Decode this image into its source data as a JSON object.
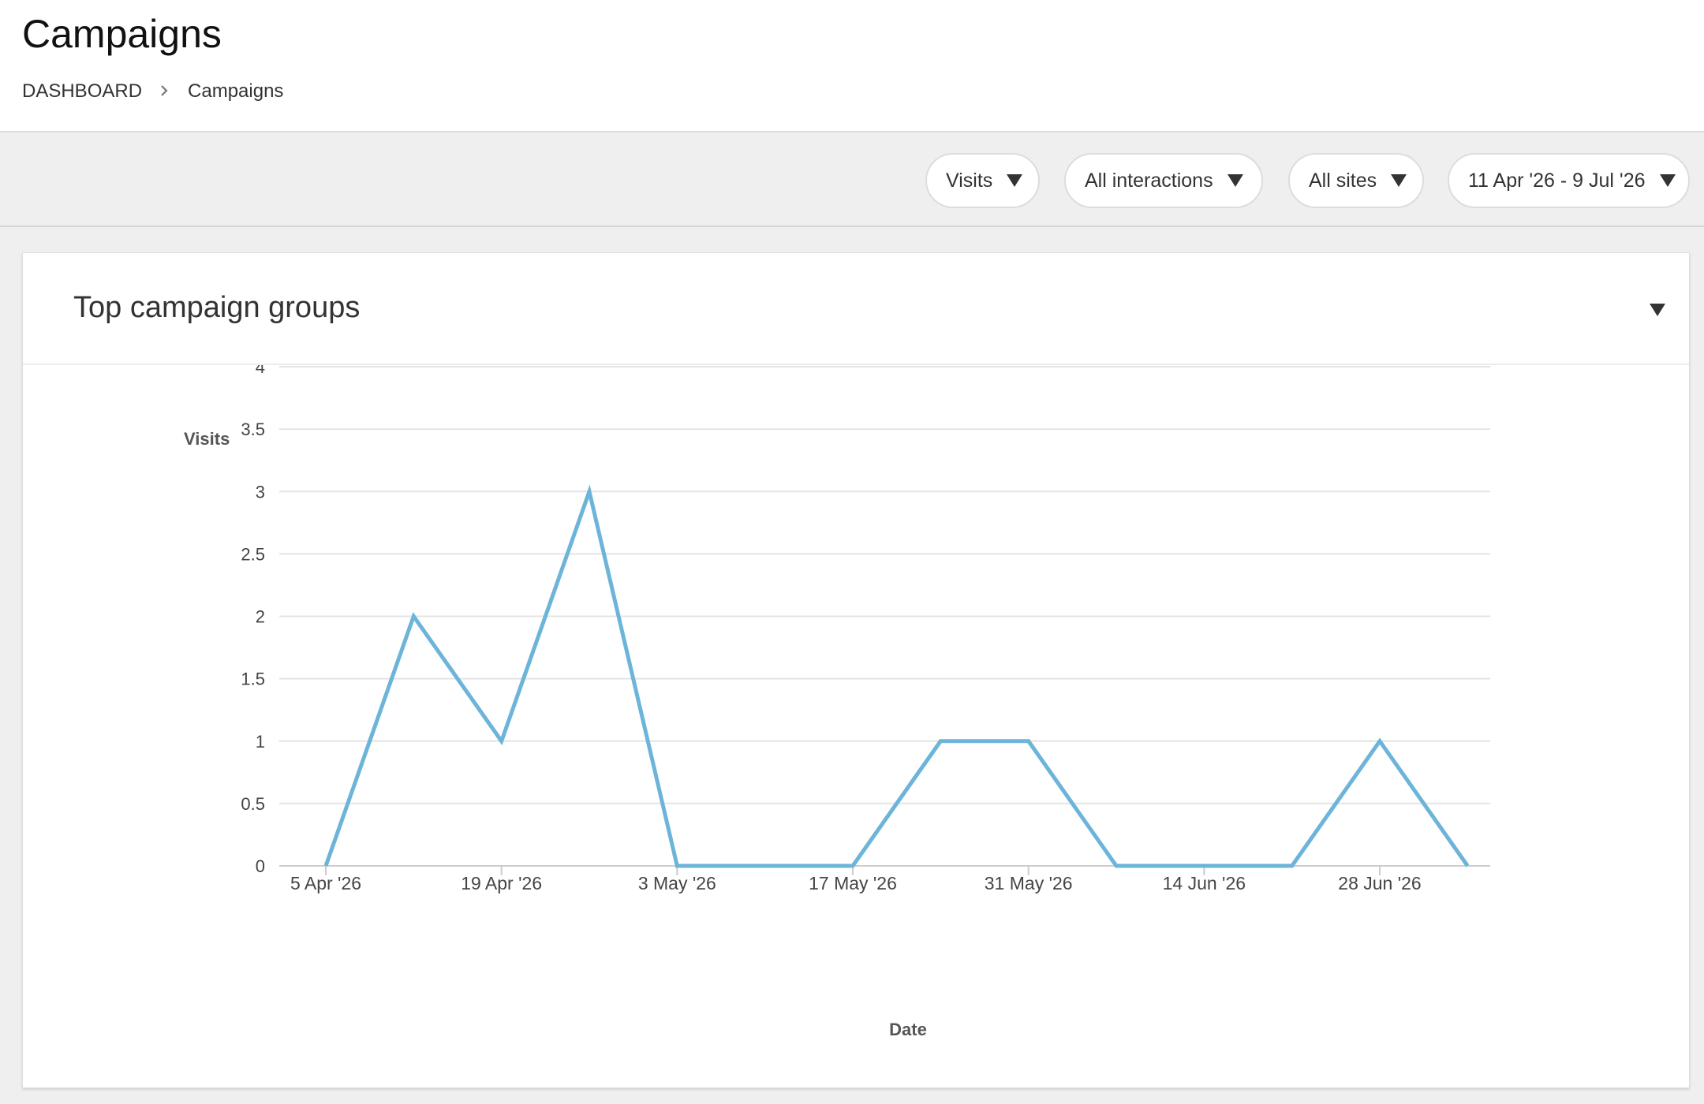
{
  "page": {
    "title": "Campaigns",
    "breadcrumb": {
      "parent": "DASHBOARD",
      "current": "Campaigns",
      "separator_icon": "chevron-right-icon"
    }
  },
  "filters": [
    {
      "label": "Visits",
      "icon": "caret-down-icon"
    },
    {
      "label": "All interactions",
      "icon": "caret-down-icon"
    },
    {
      "label": "All sites",
      "icon": "caret-down-icon"
    },
    {
      "label": "11 Apr '26 - 9 Jul '26",
      "icon": "caret-down-icon"
    }
  ],
  "card": {
    "title": "Top campaign groups",
    "toggle_icon": "caret-down-icon"
  },
  "chart_data": {
    "type": "line",
    "ylabel": "Visits",
    "xlabel": "Date",
    "ylim": [
      0,
      4
    ],
    "yticks": [
      0,
      0.5,
      1,
      1.5,
      2,
      2.5,
      3,
      3.5,
      4
    ],
    "ytick_labels": [
      "0",
      "0.5",
      "1",
      "1.5",
      "2",
      "2.5",
      "3",
      "3.5",
      "4"
    ],
    "x_range": [
      "2026-04-05",
      "2026-07-13"
    ],
    "xticks": [
      "2026-04-05",
      "2026-04-19",
      "2026-05-03",
      "2026-05-17",
      "2026-05-31",
      "2026-06-14",
      "2026-06-28"
    ],
    "xtick_labels": [
      "5 Apr '26",
      "19 Apr '26",
      "3 May '26",
      "17 May '26",
      "31 May '26",
      "14 Jun '26",
      "28 Jun '26"
    ],
    "grid": true,
    "legend": "none",
    "series": [
      {
        "color": "#6cb4d9",
        "points": [
          {
            "x": "2026-04-05",
            "y": 0
          },
          {
            "x": "2026-04-12",
            "y": 2
          },
          {
            "x": "2026-04-19",
            "y": 1
          },
          {
            "x": "2026-04-26",
            "y": 3
          },
          {
            "x": "2026-05-03",
            "y": 0
          },
          {
            "x": "2026-05-10",
            "y": 0
          },
          {
            "x": "2026-05-17",
            "y": 0
          },
          {
            "x": "2026-05-24",
            "y": 1
          },
          {
            "x": "2026-05-31",
            "y": 1
          },
          {
            "x": "2026-06-07",
            "y": 0
          },
          {
            "x": "2026-06-14",
            "y": 0
          },
          {
            "x": "2026-06-21",
            "y": 0
          },
          {
            "x": "2026-06-28",
            "y": 1
          },
          {
            "x": "2026-07-05",
            "y": 0
          }
        ]
      }
    ]
  }
}
